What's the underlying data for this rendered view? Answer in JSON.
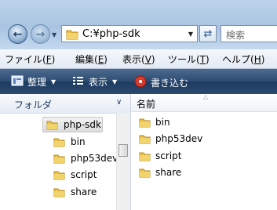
{
  "address": {
    "path": "C:¥php-sdk"
  },
  "search": {
    "placeholder": "検索"
  },
  "menu": [
    {
      "label": "ファイル(",
      "key": "F",
      "end": ")"
    },
    {
      "label": "編集(",
      "key": "E",
      "end": ")"
    },
    {
      "label": "表示(",
      "key": "V",
      "end": ")"
    },
    {
      "label": "ツール(",
      "key": "T",
      "end": ")"
    },
    {
      "label": "ヘルプ(",
      "key": "H",
      "end": ")"
    }
  ],
  "toolbar": {
    "organize": "整理",
    "view": "表示",
    "burn": "書き込む"
  },
  "nav_pane": {
    "header": "フォルダ",
    "selected": "php-sdk",
    "children": [
      "bin",
      "php53dev",
      "script",
      "share"
    ]
  },
  "file_pane": {
    "column_name": "名前",
    "items": [
      "bin",
      "php53dev",
      "script",
      "share"
    ]
  },
  "colors": {
    "toolbar": "#2e4d74",
    "folder": "#e8c04a",
    "address_bg": "#bcd3ea"
  }
}
